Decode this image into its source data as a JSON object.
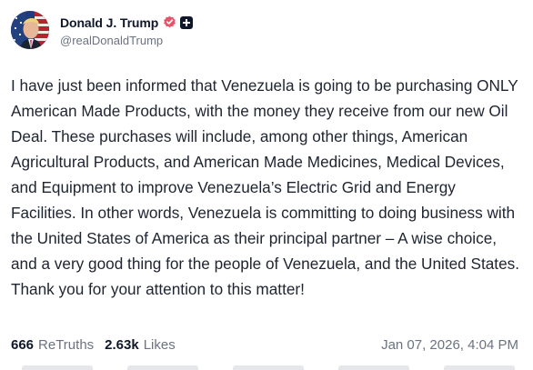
{
  "author": {
    "display_name": "Donald J. Trump",
    "handle": "@realDonaldTrump",
    "verified_icon": "verified-badge-icon",
    "plus_icon": "plus-icon",
    "verified_color": "#e5546a"
  },
  "post": {
    "text": "I have just been informed that Venezuela is going to be purchasing ONLY American Made Products, with the money they receive from our new Oil Deal. These purchases will include, among other things, American Agricultural Products, and American Made Medicines, Medical Devices, and Equipment to improve Venezuela’s Electric Grid and Energy Facilities. In other words, Venezuela is committing to doing business with the United States of America as their principal partner – A wise choice, and a very good thing for the people of Venezuela, and the United States. Thank you for your attention to this matter!"
  },
  "stats": {
    "retruths_count": "666",
    "retruths_label": "ReTruths",
    "likes_count": "2.63k",
    "likes_label": "Likes",
    "timestamp": "Jan 07, 2026, 4:04 PM"
  }
}
